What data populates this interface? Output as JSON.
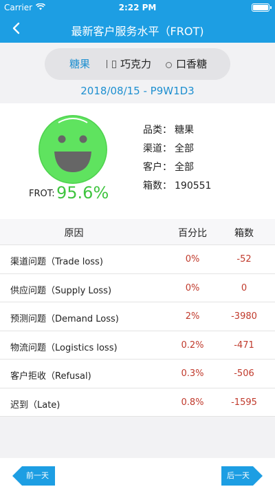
{
  "status_bar": {
    "carrier": "Carrier",
    "time": "2:22 PM"
  },
  "header": {
    "title": "最新客户服务水平（FROT)"
  },
  "tabs": [
    {
      "label": "糖果",
      "active": true
    },
    {
      "label": "巧克力",
      "icon": "chocolate-icon"
    },
    {
      "label": "口香糖",
      "icon": "gum-icon"
    }
  ],
  "date_line": "2018/08/15 - P9W1D3",
  "summary": {
    "frot_label": "FROT:",
    "frot_value": "95.6%",
    "face_color": "#5fe35f",
    "info": [
      {
        "label": "品类：",
        "value": "糖果"
      },
      {
        "label": "渠道：",
        "value": "全部"
      },
      {
        "label": "客户：",
        "value": "全部"
      },
      {
        "label": "箱数：",
        "value": "190551"
      }
    ]
  },
  "table": {
    "headers": {
      "reason": "原因",
      "percent": "百分比",
      "boxes": "箱数"
    },
    "rows": [
      {
        "reason": "渠道问题（Trade loss)",
        "percent": "0%",
        "boxes": "-52"
      },
      {
        "reason": "供应问题（Supply Loss)",
        "percent": "0%",
        "boxes": "0"
      },
      {
        "reason": "预测问题（Demand Loss)",
        "percent": "2%",
        "boxes": "-3980"
      },
      {
        "reason": "物流问题（Logistics loss)",
        "percent": "0.2%",
        "boxes": "-471"
      },
      {
        "reason": "客户拒收（Refusal)",
        "percent": "0.3%",
        "boxes": "-506"
      },
      {
        "reason": "迟到（Late)",
        "percent": "0.8%",
        "boxes": "-1595"
      }
    ]
  },
  "footer": {
    "prev_label": "前一天",
    "next_label": "后一天"
  },
  "colors": {
    "accent": "#1d9ee3",
    "negative": "#c0392b",
    "good": "#3fc43f"
  }
}
